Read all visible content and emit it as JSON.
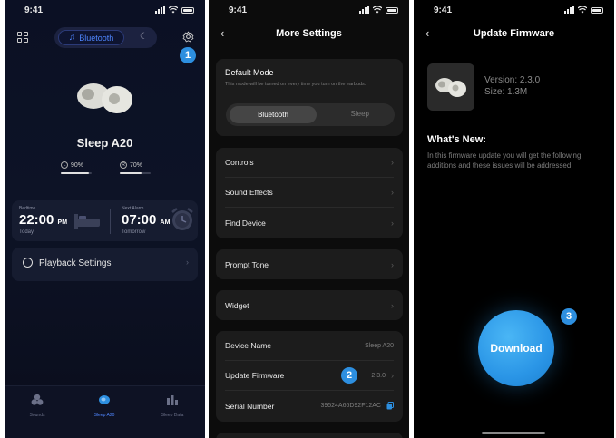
{
  "panel1": {
    "time": "9:41",
    "mode_bluetooth": "Bluetooth",
    "device_name": "Sleep A20",
    "left_battery": "90%",
    "right_battery": "70%",
    "left_battery_level": 0.9,
    "right_battery_level": 0.7,
    "bedtime_caption": "Bedtime",
    "bedtime_time": "22:00",
    "bedtime_ampm": "PM",
    "bedtime_day": "Today",
    "alarm_caption": "Next Alarm",
    "alarm_time": "07:00",
    "alarm_ampm": "AM",
    "alarm_day": "Tomorrow",
    "playback_settings": "Playback Settings",
    "marker": "1",
    "tabs": [
      {
        "label": "Sounds"
      },
      {
        "label": "Sleep A20"
      },
      {
        "label": "Sleep Data"
      }
    ]
  },
  "panel2": {
    "time": "9:41",
    "title": "More Settings",
    "default_mode_title": "Default Mode",
    "default_mode_desc": "This mode will be turned on every time you turn on the earbuds.",
    "seg_bluetooth": "Bluetooth",
    "seg_sleep": "Sleep",
    "controls": "Controls",
    "sound_effects": "Sound Effects",
    "find_device": "Find Device",
    "prompt_tone": "Prompt Tone",
    "widget": "Widget",
    "device_name_label": "Device Name",
    "device_name_value": "Sleep A20",
    "update_firmware_label": "Update Firmware",
    "update_firmware_value": "2.3.0",
    "serial_label": "Serial Number",
    "serial_value": "39524A66D92F12AC",
    "marker": "2"
  },
  "panel3": {
    "time": "9:41",
    "title": "Update Firmware",
    "version": "Version: 2.3.0",
    "size": "Size: 1.3M",
    "whats_new": "What's New:",
    "whats_new_body": "In this firmware update you will get the following additions and these issues will be addressed:",
    "download": "Download",
    "marker": "3"
  },
  "colors": {
    "accent": "#2d8fe0",
    "bluetooth_blue": "#4f86ff"
  }
}
